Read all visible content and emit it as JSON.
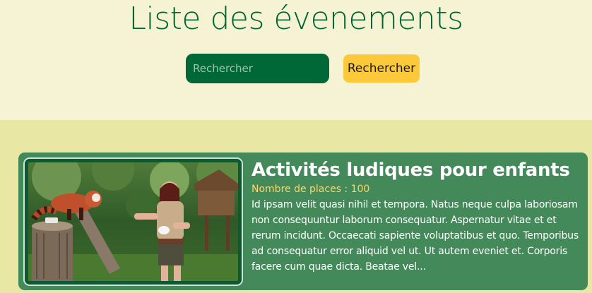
{
  "header": {
    "title": "Liste des évenements"
  },
  "search": {
    "placeholder": "Rechercher",
    "button_label": "Rechercher"
  },
  "events": [
    {
      "title": "Activités ludiques pour enfants",
      "places_label": "Nombre de places : ",
      "places_value": "100",
      "description": "Id ipsam velit quasi nihil et tempora. Natus neque culpa laboriosam non consequuntur laborum consequatur. Aspernatur vitae et et rerum incidunt. Occaecati sapiente voluptatibus et quo. Temporibus ad consequatur error aliquid vel ut. Ut autem eveniet et. Corporis facere cum quae dicta. Beatae vel...",
      "image_icon": "zookeeper-red-panda-photo"
    }
  ],
  "colors": {
    "brand_green": "#006633",
    "card_green": "#44895a",
    "accent_yellow": "#fcc93a",
    "header_bg": "#f5f3d3",
    "body_bg": "#e9e7a4"
  }
}
